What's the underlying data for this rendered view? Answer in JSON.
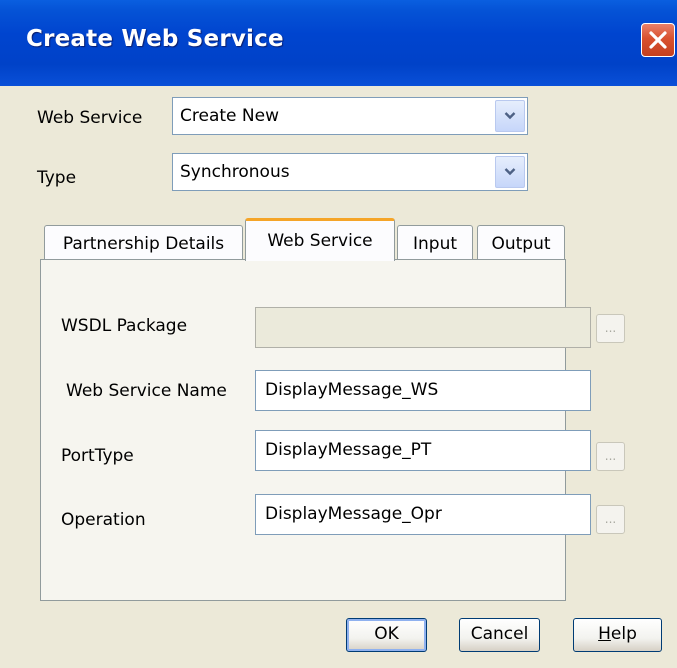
{
  "window": {
    "title": "Create Web Service"
  },
  "form": {
    "web_service_label": "Web Service",
    "web_service_value": "Create New",
    "type_label": "Type",
    "type_value": "Synchronous"
  },
  "tabs": [
    {
      "label": "Partnership Details",
      "selected": false
    },
    {
      "label": "Web Service",
      "selected": true
    },
    {
      "label": "Input",
      "selected": false
    },
    {
      "label": "Output",
      "selected": false
    }
  ],
  "panel": {
    "wsdl_package_label": "WSDL Package",
    "wsdl_package_value": "",
    "web_service_name_label": "Web Service Name",
    "web_service_name_value": "DisplayMessage_WS",
    "port_type_label": "PortType",
    "port_type_value": "DisplayMessage_PT",
    "operation_label": "Operation",
    "operation_value": "DisplayMessage_Opr",
    "browse_label": "..."
  },
  "buttons": {
    "ok": "OK",
    "cancel": "Cancel",
    "help_mnemonic": "H",
    "help_rest": "elp"
  },
  "colors": {
    "title_bar": "#0044cf",
    "close_button": "#d9512f",
    "dialog_background": "#ece9d8",
    "selected_tab_accent": "#f5a528"
  }
}
